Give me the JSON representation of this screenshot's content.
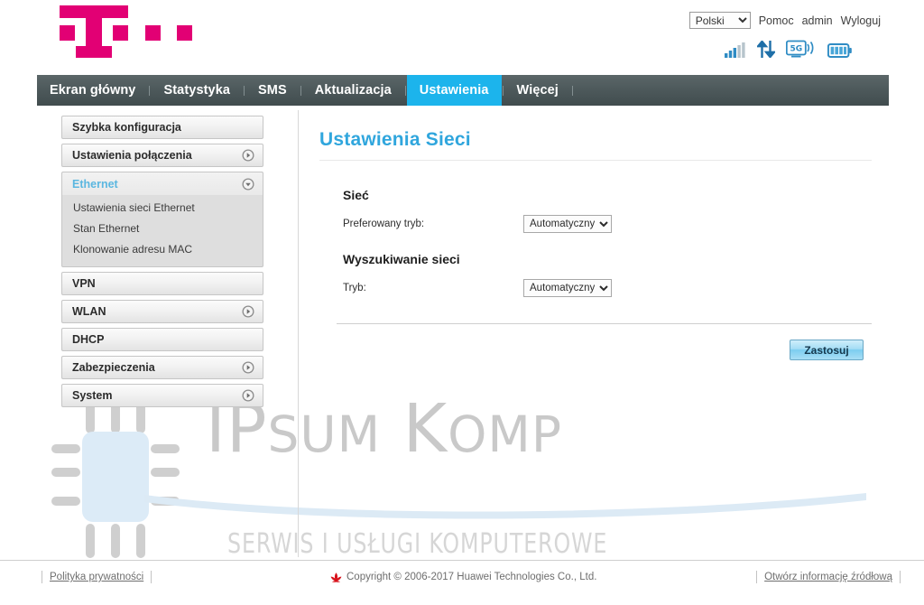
{
  "header": {
    "logo_alt": "t-mobile-logo",
    "language_selected": "Polski",
    "language_options": [
      "Polski"
    ],
    "links": [
      {
        "name": "help",
        "label": "Pomoc"
      },
      {
        "name": "account",
        "label": "admin"
      },
      {
        "name": "logout",
        "label": "Wyloguj"
      }
    ],
    "status_icons": [
      {
        "name": "signal-strength-icon",
        "label": "signal-strength",
        "bars": 5,
        "active_bars": 3
      },
      {
        "name": "data-transfer-icon",
        "label": "data-transfer-up-down"
      },
      {
        "name": "network-mode-icon",
        "label": "5G"
      },
      {
        "name": "battery-icon",
        "label": "battery-full",
        "level": 4
      }
    ]
  },
  "mainnav": {
    "items": [
      {
        "label": "Ekran główny",
        "active": false
      },
      {
        "label": "Statystyka",
        "active": false
      },
      {
        "label": "SMS",
        "active": false
      },
      {
        "label": "Aktualizacja",
        "active": false
      },
      {
        "label": "Ustawienia",
        "active": true
      },
      {
        "label": "Więcej",
        "active": false
      }
    ],
    "active_color": "#1cb4ec"
  },
  "sidebar": {
    "items": [
      {
        "label": "Szybka konfiguracja",
        "arrow": false,
        "expanded": false,
        "children": []
      },
      {
        "label": "Ustawienia połączenia",
        "arrow": true,
        "expanded": false,
        "children": []
      },
      {
        "label": "Ethernet",
        "arrow": true,
        "expanded": true,
        "children": [
          "Ustawienia sieci Ethernet",
          "Stan Ethernet",
          "Klonowanie adresu MAC"
        ]
      },
      {
        "label": "VPN",
        "arrow": false,
        "expanded": false,
        "children": []
      },
      {
        "label": "WLAN",
        "arrow": true,
        "expanded": false,
        "children": []
      },
      {
        "label": "DHCP",
        "arrow": false,
        "expanded": false,
        "children": []
      },
      {
        "label": "Zabezpieczenia",
        "arrow": true,
        "expanded": false,
        "children": []
      },
      {
        "label": "System",
        "arrow": true,
        "expanded": false,
        "children": []
      }
    ],
    "active_label_color": "#5bb7e0"
  },
  "content": {
    "page_title": "Ustawienia Sieci",
    "title_color": "#30a6dd",
    "sections": [
      {
        "heading": "Sieć",
        "rows": [
          {
            "label": "Preferowany tryb:",
            "control": "select",
            "value": "Automatyczny",
            "options": [
              "Automatyczny"
            ]
          }
        ]
      },
      {
        "heading": "Wyszukiwanie sieci",
        "rows": [
          {
            "label": "Tryb:",
            "control": "select",
            "value": "Automatyczny",
            "options": [
              "Automatyczny"
            ]
          }
        ]
      }
    ],
    "apply_label": "Zastosuj"
  },
  "footer": {
    "privacy_label": "Polityka prywatności",
    "copyright": "Copyright © 2006-2017 Huawei Technologies Co., Ltd.",
    "source_label": "Otwórz informację źródłową"
  },
  "watermark": {
    "brand_i": "IP",
    "brand_rest": "SUM",
    "brand_k": "K",
    "brand_k_rest": "OMP",
    "tagline": "SERWIS I USŁUGI KOMPUTEROWE"
  }
}
